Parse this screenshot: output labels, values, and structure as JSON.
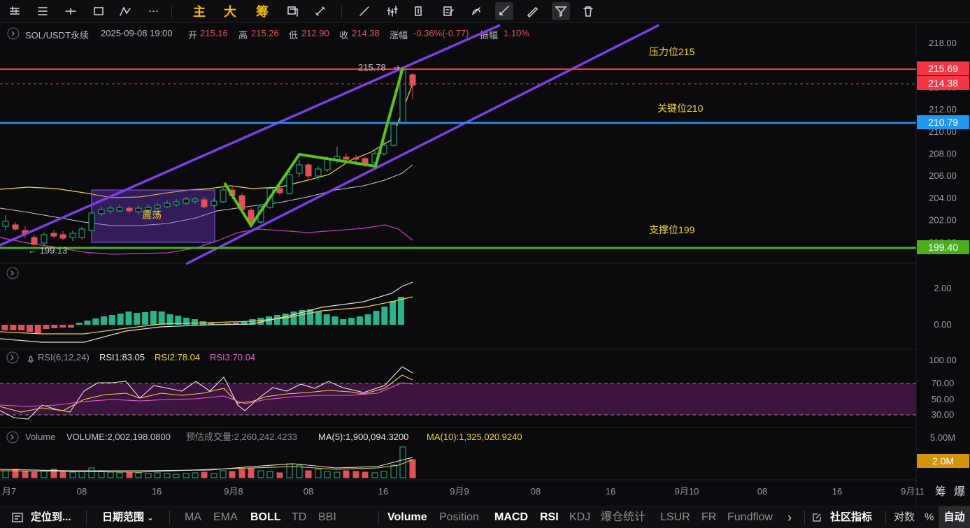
{
  "toolbar": {
    "tools": [
      "menu-icon",
      "list-icon",
      "horizontal-line-icon",
      "rectangle-icon",
      "indicator-icon",
      "more-icon",
      "tool-1-icon",
      "tool-2-icon",
      "tool-3-icon",
      "tool-4-icon",
      "tool-5-icon",
      "tool-6-icon",
      "tool-7-icon",
      "tool-8-icon",
      "tool-9-icon",
      "filter-icon",
      "trash-icon"
    ],
    "chars": [
      "主",
      "大",
      "筹"
    ]
  },
  "header": {
    "symbol": "SOL/USDT永续",
    "datetime": "2025-09-08 19:00",
    "open_label": "开",
    "open": "215.16",
    "high_label": "高",
    "high": "215.26",
    "low_label": "低",
    "low": "212.90",
    "close_label": "收",
    "close": "214.38",
    "change_label": "涨幅",
    "change": "-0.36%(-0.77)",
    "amp_label": "振幅",
    "amp": "1.10%"
  },
  "annotations": {
    "resistance": "压力位215",
    "key": "关键位210",
    "support": "支撑位199",
    "range": "震荡",
    "high_marker": "215.78",
    "low_marker": "← 199.13"
  },
  "price_tags": {
    "resistance": {
      "text": "215.69",
      "color": "#f23645"
    },
    "last": {
      "text": "214.38",
      "color": "#f23645"
    },
    "key": {
      "text": "210.79",
      "color": "#2196f3"
    },
    "support": {
      "text": "199.40",
      "color": "#4caf1f"
    },
    "volume": {
      "text": "2.0M",
      "color": "#d4940a"
    }
  },
  "price_axis": [
    "218.00",
    "216.00",
    "214.00",
    "212.00",
    "210.00",
    "208.00",
    "206.00",
    "204.00",
    "202.00",
    "200.00"
  ],
  "macd_axis": [
    "2.00",
    "0.00"
  ],
  "rsi": {
    "name": "RSI(6,12,24)",
    "rsi1": "RSI1:83.05",
    "rsi2": "RSI2:78.04",
    "rsi3": "RSI3:70.04",
    "axis": [
      "100.00",
      "70.00",
      "50.00",
      "30.00"
    ]
  },
  "volume": {
    "name": "Volume",
    "volume": "VOLUME:2,002,198.0800",
    "estimate": "预估成交量:2,260,242.4233",
    "ma5": "MA(5):1,900,094.3200",
    "ma10": "MA(10):1,325,020.9240",
    "axis_top": "5.00M"
  },
  "time_axis": [
    "月7",
    "08",
    "16",
    "9月8",
    "08",
    "16",
    "9月9",
    "08",
    "16",
    "9月10",
    "08",
    "16",
    "9月11"
  ],
  "corner": [
    "筹",
    "爆"
  ],
  "bottom": {
    "locate": "定位到...",
    "range": "日期范围",
    "indicators": [
      "MA",
      "EMA",
      "BOLL",
      "TD",
      "BBI"
    ],
    "sub_indicators": [
      "Volume",
      "Position",
      "MACD",
      "RSI",
      "KDJ",
      "爆仓统计",
      "LSUR",
      "FR",
      "Fundflow"
    ],
    "community": "社区指标",
    "log": "对数",
    "pct": "%",
    "auto": "自动"
  },
  "colors": {
    "up": "#2bb28b",
    "down": "#e05257",
    "channel": "#7b3fe4",
    "pattern": "#58c322",
    "boll_mid": "#e6e6e6",
    "boll_up": "#f3d23a",
    "boll_low": "#c23cb6"
  }
}
